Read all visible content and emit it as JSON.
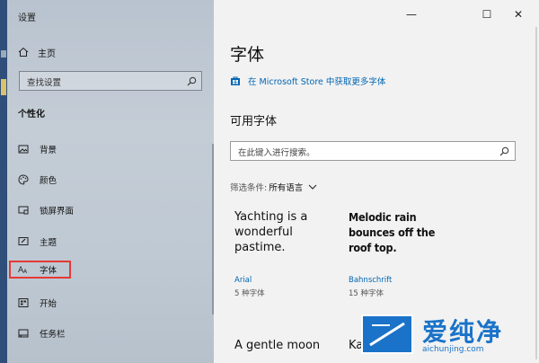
{
  "window": {
    "title": "设置"
  },
  "controls": {
    "minimize": "—",
    "maximize": "☐",
    "close": "✕"
  },
  "sidebar": {
    "home_label": "主页",
    "search_placeholder": "查找设置",
    "section_title": "个性化",
    "items": [
      {
        "label": "背景",
        "icon": "picture-icon"
      },
      {
        "label": "颜色",
        "icon": "palette-icon"
      },
      {
        "label": "锁屏界面",
        "icon": "lock-screen-icon"
      },
      {
        "label": "主题",
        "icon": "brush-icon"
      },
      {
        "label": "字体",
        "icon": "font-icon",
        "selected": true
      },
      {
        "label": "开始",
        "icon": "start-icon"
      },
      {
        "label": "任务栏",
        "icon": "taskbar-icon"
      }
    ]
  },
  "main": {
    "title": "字体",
    "store_link": "在 Microsoft Store 中获取更多字体",
    "available_title": "可用字体",
    "search_placeholder": "在此键入进行搜索。",
    "filter_label": "筛选条件:",
    "filter_value": "所有语言",
    "fonts": [
      {
        "sample": "Yachting is a wonderful pastime.",
        "name": "Arial",
        "count": "5 种字体"
      },
      {
        "sample": "Melodic rain bounces off the roof top.",
        "name": "Bahnschrift",
        "count": "15 种字体"
      },
      {
        "sample": "A gentle moon",
        "name": "",
        "count": ""
      },
      {
        "sample": "Ka",
        "name": "",
        "count": ""
      }
    ]
  },
  "watermark": {
    "text": "爱纯净",
    "url": "aichunjing.com"
  },
  "colors": {
    "accent": "#0066b4",
    "highlight": "#e53935",
    "watermark": "#1a73c8"
  }
}
